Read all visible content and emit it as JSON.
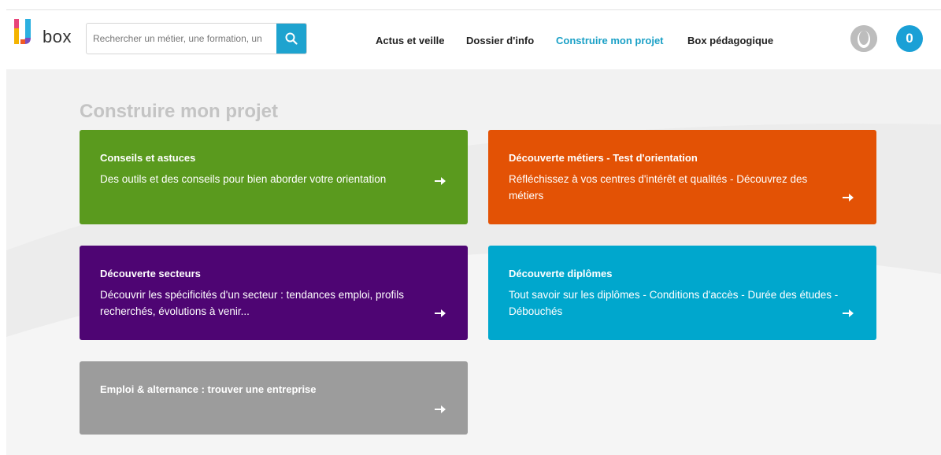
{
  "header": {
    "logo_text": "box",
    "search": {
      "placeholder": "Rechercher un métier, une formation, un"
    },
    "nav": [
      {
        "label": "Actus et veille",
        "active": false
      },
      {
        "label": "Dossier d'info",
        "active": false
      },
      {
        "label": "Construire mon projet",
        "active": true
      },
      {
        "label": "Box pédagogique",
        "active": false
      }
    ],
    "cart_count": "0"
  },
  "page": {
    "title": "Construire mon projet",
    "cards": [
      {
        "title": "Conseils et astuces",
        "description": "Des outils et des conseils pour bien aborder votre orientation",
        "color": "#5a9a1e"
      },
      {
        "title": "Découverte métiers - Test d'orientation",
        "description": "Réfléchissez à vos centres d'intérêt et qualités - Découvrez des métiers",
        "color": "#e35205"
      },
      {
        "title": "Découverte secteurs",
        "description": "Découvrir les spécificités d'un secteur : tendances emploi, profils recherchés, évolutions à venir...",
        "color": "#4e0573"
      },
      {
        "title": "Découverte diplômes",
        "description": "Tout savoir sur les diplômes - Conditions d'accès - Durée des études - Débouchés",
        "color": "#00a7cd"
      },
      {
        "title": "Emploi & alternance : trouver une entreprise",
        "description": "",
        "color": "#9c9c9c"
      }
    ]
  },
  "colors": {
    "accent": "#1aa0c6",
    "title_gray": "#c4c4c4"
  }
}
